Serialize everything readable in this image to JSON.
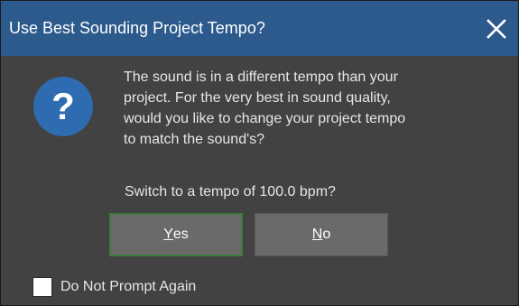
{
  "dialog": {
    "title": "Use Best Sounding Project Tempo?",
    "close_icon": "close-icon",
    "question_icon": "question-mark-icon",
    "message_lines": [
      "The sound is in a different tempo than your",
      "project.  For the very best in sound quality,",
      "would you like to change your project tempo",
      "to match the sound's?"
    ],
    "prompt": "Switch to a tempo of 100.0 bpm?",
    "yes_button": {
      "accel": "Y",
      "rest": "es"
    },
    "no_button": {
      "accel": "N",
      "rest": "o"
    },
    "checkbox": {
      "label": "Do Not Prompt Again",
      "checked": false
    }
  },
  "colors": {
    "titlebar": "#2d5a8c",
    "body": "#424242",
    "button": "#6a6a6a",
    "default_button_border": "#3f7a3a",
    "icon_circle": "#2f6bb0"
  }
}
